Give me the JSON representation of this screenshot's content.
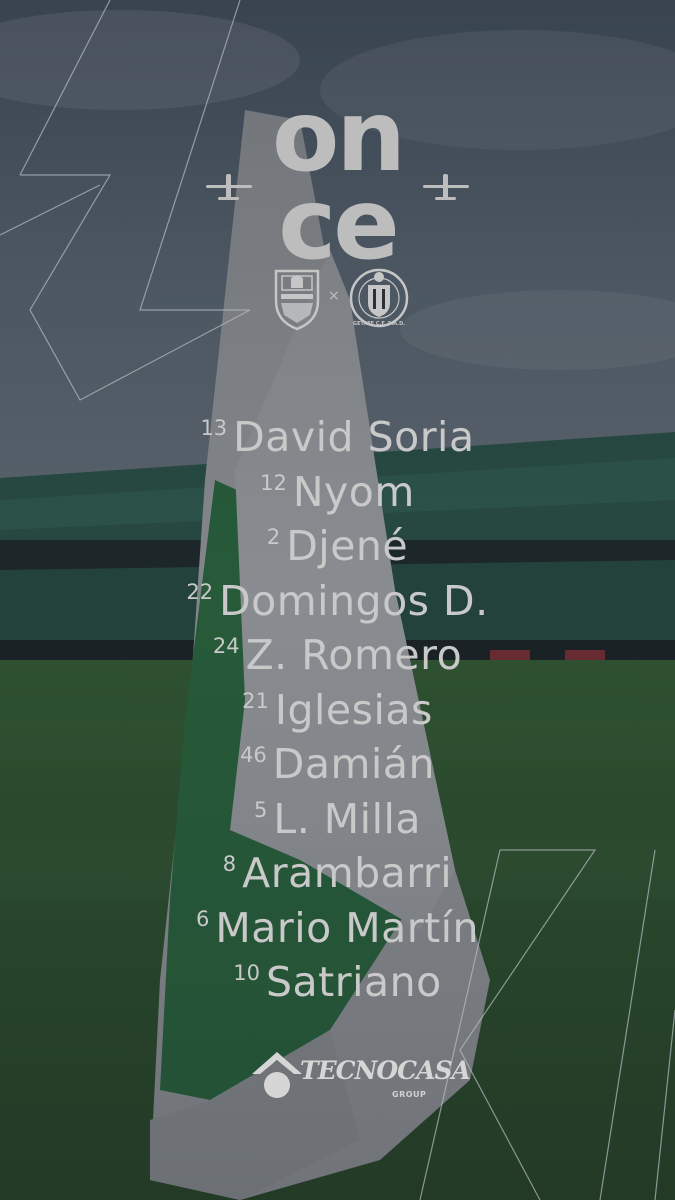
{
  "title": {
    "line1": "on",
    "line2": "ce"
  },
  "match": {
    "separator": "×"
  },
  "lineup": [
    {
      "number": "13",
      "name": "David Soria"
    },
    {
      "number": "12",
      "name": "Nyom"
    },
    {
      "number": "2",
      "name": "Djené"
    },
    {
      "number": "22",
      "name": "Domingos D."
    },
    {
      "number": "24",
      "name": "Z. Romero"
    },
    {
      "number": "21",
      "name": "Iglesias"
    },
    {
      "number": "46",
      "name": "Damián"
    },
    {
      "number": "5",
      "name": "L. Milla"
    },
    {
      "number": "8",
      "name": "Arambarri"
    },
    {
      "number": "6",
      "name": "Mario Martín"
    },
    {
      "number": "10",
      "name": "Satriano"
    }
  ],
  "sponsor": {
    "name": "TECNOCASA",
    "sub": "GROUP"
  },
  "crest_right_text": "GETAFE C.F. S.A.D.",
  "colors": {
    "overlay": "#2a3038",
    "text": "#c9c9c9",
    "flag_green": "#2f8a48",
    "flag_white": "#d8dadc"
  }
}
